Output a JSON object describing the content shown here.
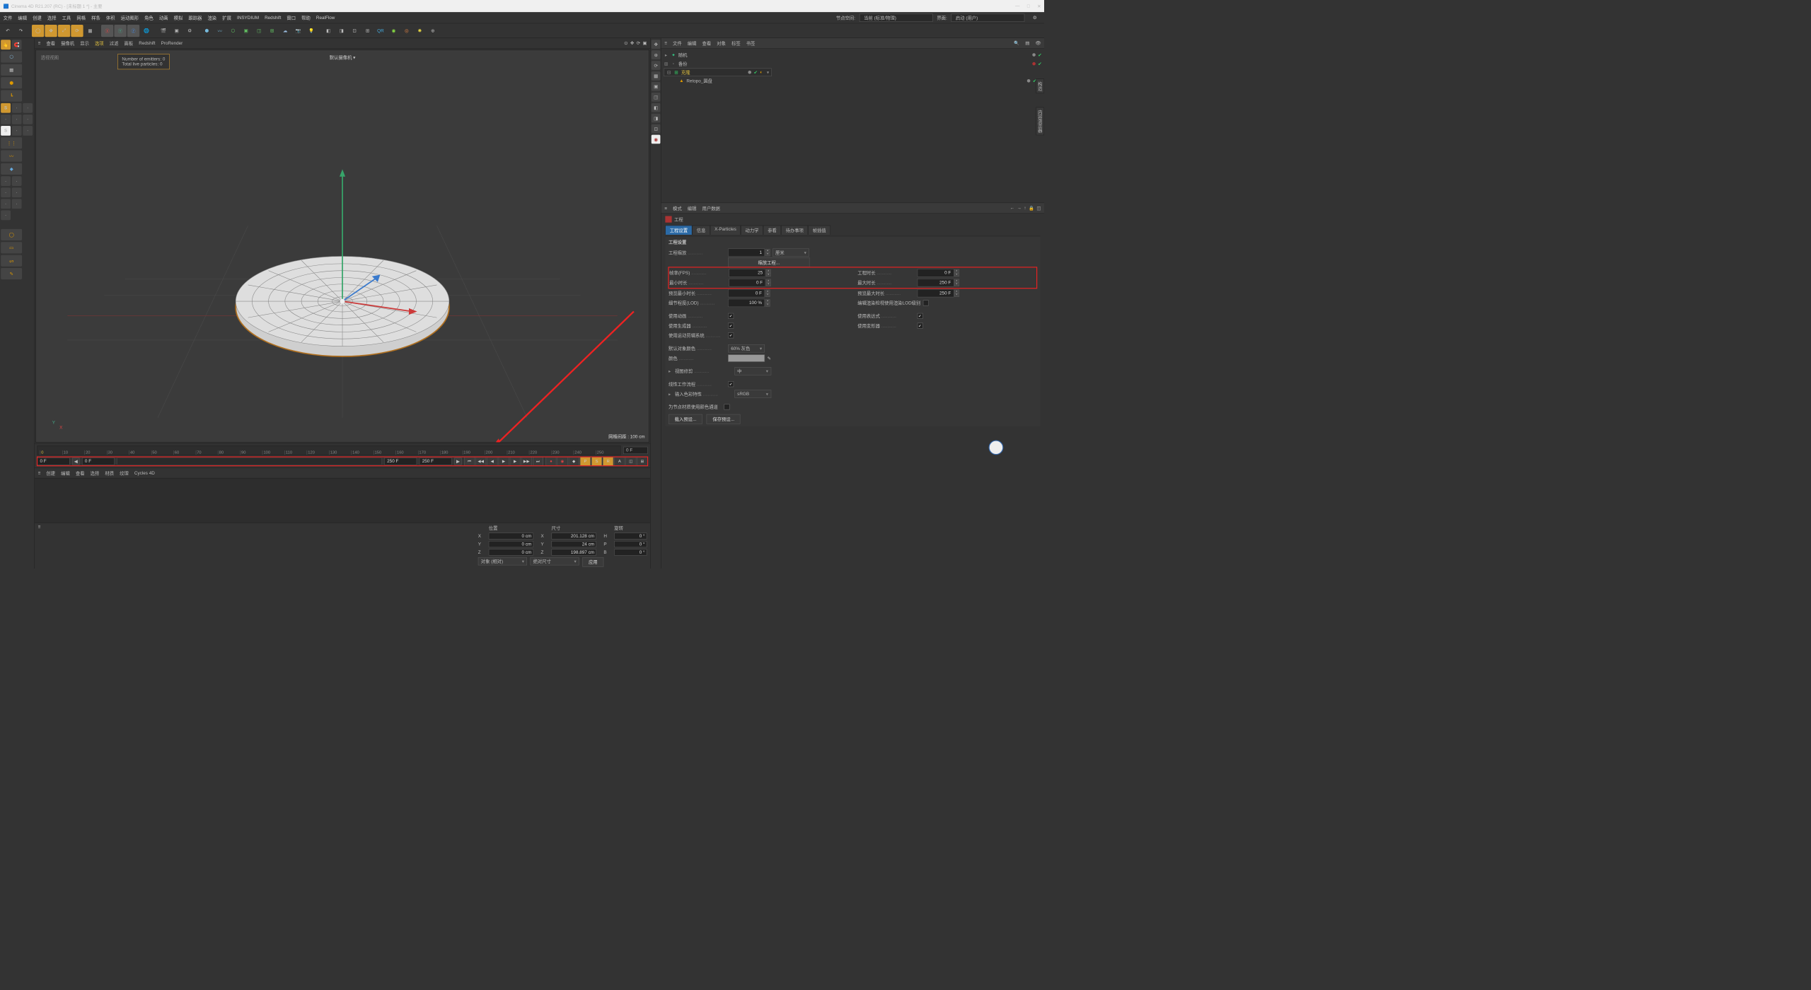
{
  "title": "Cinema 4D R21.207 (RC) - [未标题 1 *] - 主要",
  "winButtons": [
    "—",
    "□",
    "✕"
  ],
  "menu": [
    "文件",
    "编辑",
    "创建",
    "选择",
    "工具",
    "网格",
    "样条",
    "体积",
    "运动图形",
    "角色",
    "动画",
    "模拟",
    "跟踪器",
    "渲染",
    "扩展",
    "INSYDIUM",
    "Redshift",
    "窗口",
    "帮助",
    "RealFlow"
  ],
  "menuRight": {
    "nodeSpaceLabel": "节点空间:",
    "nodeSpaceValue": "当前 (标准/物理)",
    "layoutLabel": "界面:",
    "layoutValue": "启动 (用户)"
  },
  "vpTabs": [
    "查看",
    "摄像机",
    "显示",
    "选项",
    "过滤",
    "面板",
    "Redshift",
    "ProRender"
  ],
  "vp": {
    "label": "透视视图",
    "cam": "默认摄像机 ▾",
    "hudL1": "Number of emitters: 0",
    "hudL2": "Total live particles: 0",
    "grid": "网格间距 : 100 cm"
  },
  "omMenu": [
    "文件",
    "编辑",
    "查看",
    "对象",
    "标签",
    "书签"
  ],
  "omItems": [
    {
      "name": "随机",
      "color": "#2a8",
      "sel": false,
      "depth": 0,
      "icon": "rand"
    },
    {
      "name": "备份",
      "color": "#888",
      "sel": false,
      "depth": 0,
      "icon": "null"
    },
    {
      "name": "克隆",
      "color": "#3c6",
      "sel": true,
      "depth": 0,
      "icon": "cloner"
    },
    {
      "name": "Retopo_圆盘",
      "color": "#d90",
      "sel": false,
      "depth": 1,
      "icon": "poly"
    }
  ],
  "amMenu": [
    "模式",
    "编辑",
    "用户数据"
  ],
  "attrHeader": "工程",
  "attrTabs": [
    "工程设置",
    "信息",
    "X-Particles",
    "动力学",
    "参看",
    "待办事项",
    "帧插值"
  ],
  "attrs": {
    "sectionTitle": "工程设置",
    "scaleLabel": "工程缩放",
    "scaleVal": "1",
    "scaleUnit": "厘米",
    "scaleBtn": "缩放工程...",
    "fpsLabel": "帧率(FPS)",
    "fpsVal": "25",
    "durLabel": "工程时长",
    "durVal": "0 F",
    "minLabel": "最小时长",
    "minVal": "0 F",
    "maxLabel": "最大时长",
    "maxVal": "250 F",
    "pminLabel": "预览最小时长",
    "pminVal": "0 F",
    "pmaxLabel": "预览最大时长",
    "pmaxVal": "250 F",
    "lodLabel": "细节程度(LOD)",
    "lodVal": "100 %",
    "lodRenderLabel": "编辑渲染检视使用渲染LOD级别",
    "useAnimLabel": "使用动画",
    "useExprLabel": "使用表达式",
    "useGenLabel": "使用生成器",
    "useDefLabel": "使用变形器",
    "useMotionLabel": "使用运动剪辑系统",
    "defColLabel": "默认对象颜色",
    "defColVal": "60% 灰色",
    "colorLabel": "颜色",
    "clipLabel": "视图修剪",
    "clipVal": "中",
    "linearLabel": "线性工作流程",
    "inputProfLabel": "输入色彩特性",
    "inputProfVal": "sRGB",
    "nodeMatLabel": "为节点材质使用颜色通道",
    "loadPreset": "载入预设...",
    "savePreset": "保存预设..."
  },
  "timeline": {
    "ticks": [
      "0",
      "10",
      "20",
      "30",
      "40",
      "50",
      "60",
      "70",
      "80",
      "90",
      "100",
      "110",
      "120",
      "130",
      "140",
      "150",
      "160",
      "170",
      "180",
      "190",
      "200",
      "210",
      "220",
      "230",
      "240",
      "250"
    ],
    "curLabel": "0 F",
    "startVal": "0 F",
    "endVal": "250 F",
    "end2Val": "250 F",
    "rightEnd": "0 F"
  },
  "matMenu": [
    "创建",
    "编辑",
    "查看",
    "选择",
    "材质",
    "纹理",
    "Cycles 4D"
  ],
  "coords": {
    "headers": [
      "位置",
      "尺寸",
      "旋转"
    ],
    "rows": [
      {
        "a": "X",
        "p": "0 cm",
        "s": "201.128 cm",
        "r": "H",
        "rv": "0 °"
      },
      {
        "a": "Y",
        "p": "0 cm",
        "s": "24 cm",
        "r": "P",
        "rv": "0 °"
      },
      {
        "a": "Z",
        "p": "0 cm",
        "s": "198.897 cm",
        "r": "B",
        "rv": "0 °"
      }
    ],
    "modeLabel": "对象 (相对)",
    "sizeModeLabel": "绝对尺寸",
    "applyLabel": "应用"
  },
  "sideTabs": [
    "构造",
    "内容浏览器"
  ]
}
